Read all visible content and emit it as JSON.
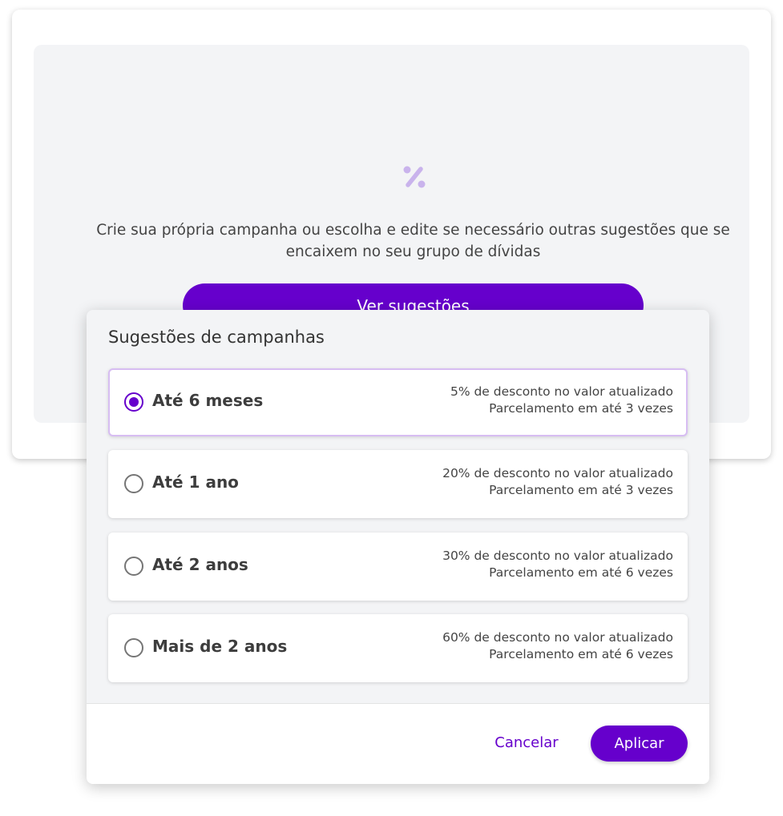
{
  "background": {
    "icon": "percent-icon",
    "description": "Crie sua própria campanha ou escolha e edite se necessário outras sugestões que se encaixem no seu grupo de dívidas",
    "suggestions_button_label": "Ver sugestões"
  },
  "modal": {
    "title": "Sugestões de campanhas",
    "options": [
      {
        "label": "Até 6 meses",
        "discount": "5% de desconto no valor atualizado",
        "installments": "Parcelamento em até 3 vezes",
        "selected": true
      },
      {
        "label": "Até 1 ano",
        "discount": "20% de desconto no valor atualizado",
        "installments": "Parcelamento em até 3 vezes",
        "selected": false
      },
      {
        "label": "Até 2 anos",
        "discount": "30% de desconto no valor atualizado",
        "installments": "Parcelamento em até 6 vezes",
        "selected": false
      },
      {
        "label": "Mais de 2 anos",
        "discount": "60% de desconto no valor atualizado",
        "installments": "Parcelamento em até 6 vezes",
        "selected": false
      }
    ],
    "cancel_label": "Cancelar",
    "apply_label": "Aplicar"
  },
  "colors": {
    "primary": "#6600cc",
    "icon_accent": "#c9b3ec",
    "panel_background": "#f3f4f6",
    "selected_border": "#d7bdf2"
  }
}
